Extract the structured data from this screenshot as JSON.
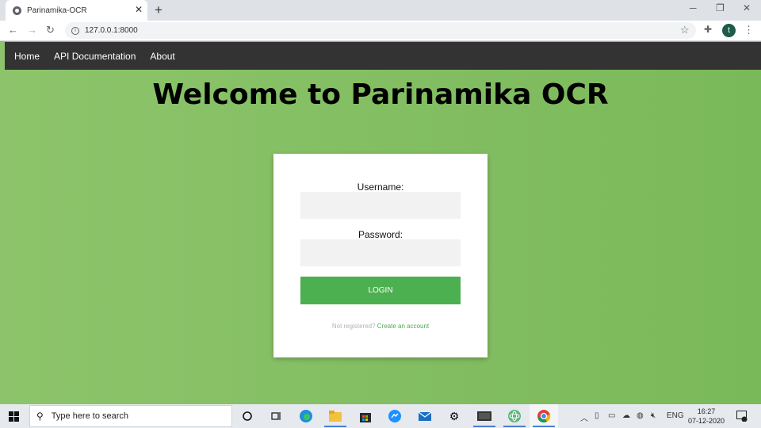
{
  "browser": {
    "tab_title": "Parinamika-OCR",
    "tab_close": "✕",
    "new_tab": "+",
    "url": "127.0.0.1:8000",
    "avatar_letter": "t",
    "window_controls": {
      "minimize": "─",
      "restore": "❐",
      "close": "✕"
    },
    "nav": {
      "back": "←",
      "forward": "→",
      "reload": "↻"
    }
  },
  "site_nav": {
    "items": [
      {
        "label": "Home"
      },
      {
        "label": "API Documentation"
      },
      {
        "label": "About"
      }
    ]
  },
  "page": {
    "heading": "Welcome to Parinamika OCR"
  },
  "login_form": {
    "username_label": "Username:",
    "username_value": "",
    "password_label": "Password:",
    "password_value": "",
    "login_button": "LOGIN",
    "register_prompt": "Not registered?",
    "register_link": "Create an account"
  },
  "taskbar": {
    "search_placeholder": "Type here to search",
    "language": "ENG",
    "time": "16:27",
    "date": "07-12-2020",
    "notification_count": "1"
  },
  "colors": {
    "page_background": "#7fbd5a",
    "nav_background": "#333333",
    "login_button": "#4caf50",
    "link": "#4caf50"
  }
}
